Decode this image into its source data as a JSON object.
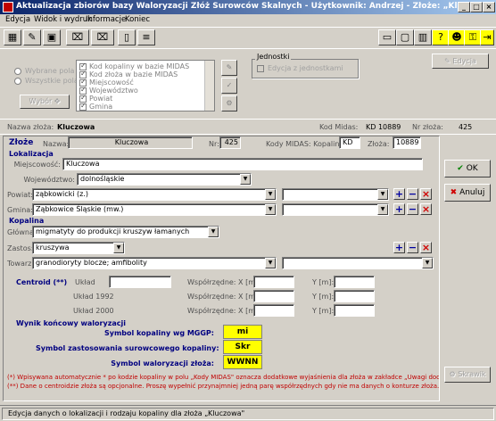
{
  "window": {
    "title": "Aktualizacja zbiorów bazy Waloryzacji Złóż Surowców Skalnych - Użytkownik: Andrzej - Złoże: „Kluczowa\""
  },
  "menu": [
    "Edycja",
    "Widok i wydruk",
    "Informacje",
    "Koniec"
  ],
  "toolbar": {
    "help_label": "?"
  },
  "selection": {
    "radio_selected_label": "Wybrane pola",
    "radio_all_label": "Wszystkie pola",
    "choose_label": "Wybór",
    "fields": [
      "Kod kopaliny w bazie MIDAS",
      "Kod złoża w bazie MIDAS",
      "Miejscowość",
      "Województwo",
      "Powiat",
      "Gmina"
    ]
  },
  "units": {
    "title": "Jednostki",
    "checkbox_label": "Edycja z jednostkami"
  },
  "edit_button": "Edycja",
  "header": {
    "name_label": "Nazwa złoża:",
    "name_value": "Kluczowa",
    "midas_label": "Kod Midas:",
    "midas_value": "KD 10889",
    "nr_label": "Nr złoża:",
    "nr_value": "425"
  },
  "deposit": {
    "section": "Złoże",
    "name_label": "Nazwa:",
    "name_value": "Kluczowa",
    "nr_label": "Nr:",
    "nr_value": "425",
    "midas_label": "Kody MIDAS: Kopaliny*:",
    "kopaliny_value": "KD",
    "zloza_label": "Złoża:",
    "zloza_value": "10889"
  },
  "location": {
    "section": "Lokalizacja",
    "town_label": "Miejscowość:",
    "town_value": "Kluczowa",
    "voiv_label": "Województwo:",
    "voiv_value": "dolnośląskie",
    "powiat_label": "Powiat:",
    "powiat_value": "ząbkowicki (z.)",
    "gmina_label": "Gmina:",
    "gmina_value": "Ząbkowice Śląskie (mw.)"
  },
  "mineral": {
    "section": "Kopalina",
    "main_label": "Główna:",
    "main_value": "migmatyty do produkcji kruszyw łamanych",
    "use_label": "Zastos:",
    "use_value": "kruszywa",
    "goods_label": "Towarz.:",
    "goods_value": "granodioryty blocze; amfibolity"
  },
  "centroid": {
    "section": "Centroid (**)",
    "rows": [
      {
        "label": "Układ",
        "coord_label": "Współrzędne: X [m]:",
        "y_label": "Y [m]:"
      },
      {
        "label": "Układ 1992",
        "coord_label": "Współrzędne: X [m]:",
        "y_label": "Y [m]:"
      },
      {
        "label": "Układ 2000",
        "coord_label": "Współrzędne: X [m]:",
        "y_label": "Y [m]:"
      }
    ]
  },
  "result": {
    "section": "Wynik końcowy waloryzacji",
    "rows": [
      {
        "label": "Symbol kopaliny wg MGGP:",
        "value": "mi"
      },
      {
        "label": "Symbol zastosowania surowcowego kopaliny:",
        "value": "Skr"
      },
      {
        "label": "Symbol waloryzacji złoża:",
        "value": "WWNN"
      }
    ]
  },
  "notes": {
    "note1": "(*) Wpisywana automatycznie * po kodzie kopaliny w polu „Kody MIDAS\" oznacza dodatkowe wyjaśnienia dla złoża w zakładce „Uwagi dodatkowe\"",
    "note2": "(**) Dane o centroidzie złoża są opcjonalne. Proszę wypełnić przynajmniej jedną parę współrzędnych gdy nie ma danych o konturze złoża."
  },
  "buttons": {
    "ok": "OK",
    "cancel": "Anuluj",
    "map": "Skrawik"
  },
  "status": "Edycja danych o lokalizacji i rodzaju kopaliny dla złoża „Kluczowa\""
}
